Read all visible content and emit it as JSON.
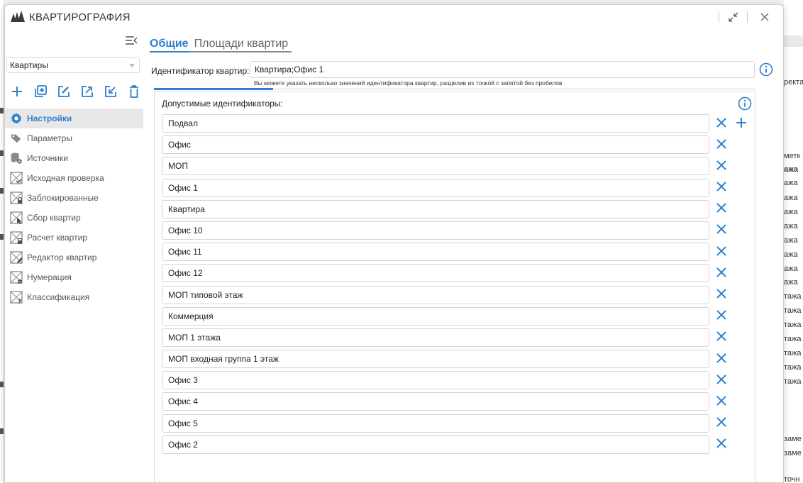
{
  "window": {
    "title": "КВАРТИРОГРАФИЯ"
  },
  "sidebar": {
    "select_value": "Квартиры",
    "nav": [
      {
        "label": "Настройки",
        "icon": "gear-icon",
        "active": true
      },
      {
        "label": "Параметры",
        "icon": "tags-icon",
        "active": false
      },
      {
        "label": "Источники",
        "icon": "database-gear-icon",
        "active": false
      },
      {
        "label": "Исходная проверка",
        "icon": "plan-check-icon",
        "active": false
      },
      {
        "label": "Заблокированные",
        "icon": "plan-lock-icon",
        "active": false
      },
      {
        "label": "Сбор квартир",
        "icon": "plan-cursor-icon",
        "active": false
      },
      {
        "label": "Расчет квартир",
        "icon": "plan-calculator-icon",
        "active": false
      },
      {
        "label": "Редактор квартир",
        "icon": "plan-edit-icon",
        "active": false
      },
      {
        "label": "Нумерация",
        "icon": "plan-hash-icon",
        "active": false
      },
      {
        "label": "Классификация",
        "icon": "plan-question-icon",
        "active": false
      }
    ]
  },
  "tabs": [
    {
      "label": "Общие",
      "active": true
    },
    {
      "label": "Площади квартир",
      "active": false
    }
  ],
  "settings": {
    "id_label": "Идентификатор квартир:",
    "id_value": "Квартира;Офис 1",
    "id_hint": "Вы можете указать несколько значений идентификатора квартир, разделив их точкой с запятой без пробелов",
    "allowed_title": "Допустимые идентификаторы:",
    "allowed": [
      "Подвал",
      "Офис",
      "МОП",
      "Офис 1",
      "Квартира",
      "Офис 10",
      "Офис 11",
      "Офис 12",
      "МОП типовой этаж",
      "Коммерция",
      "МОП 1 этажа",
      "МОП входная группа 1 этаж",
      "Офис 3",
      "Офис 4",
      "Офис 5",
      "Офис 2"
    ]
  },
  "background_app": {
    "right_texts": [
      "ректа",
      "метк",
      "ажа",
      "ажа",
      "ажа",
      "ажа",
      "ажа",
      "ажа",
      "ажа",
      "ажа",
      "ажа",
      "тажа",
      "тажа",
      "тажа",
      "тажа",
      "тажа",
      "тажа",
      "тажа",
      "заме",
      "заме",
      "точн"
    ]
  },
  "colors": {
    "accent": "#2f7fcf",
    "active_bg": "#e8e8e8",
    "icon_gray": "#8a8a8a"
  }
}
